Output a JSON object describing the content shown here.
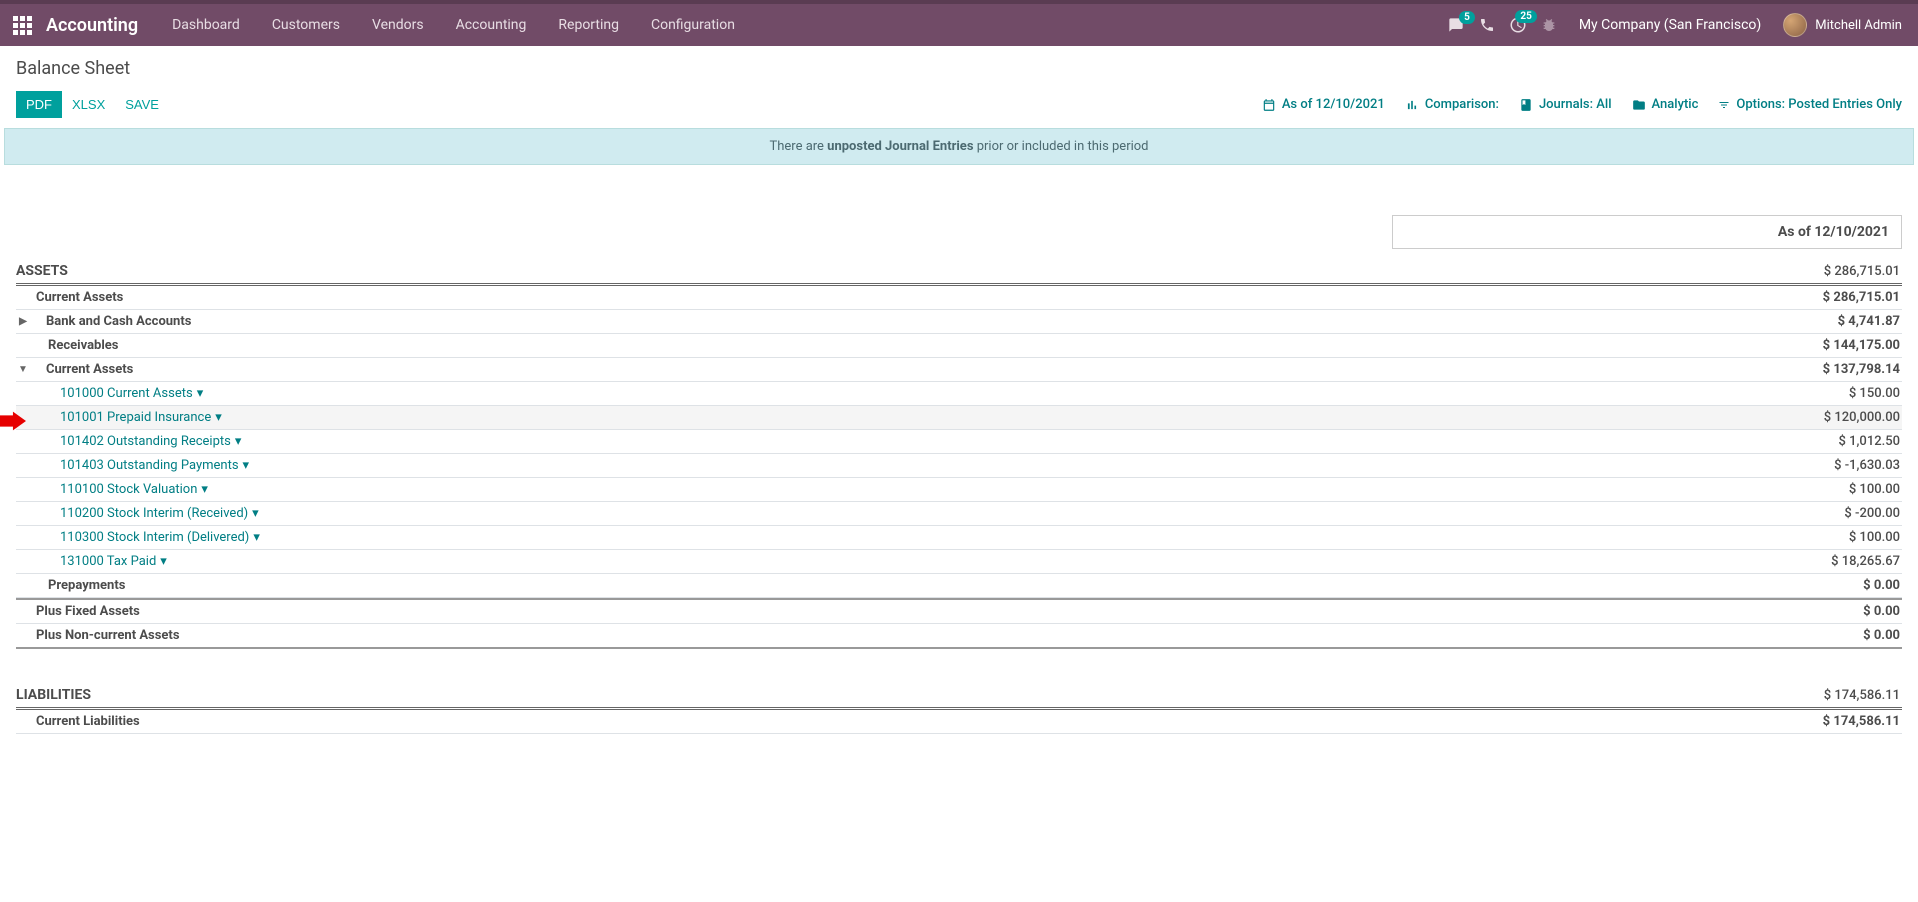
{
  "topbar": {
    "brand": "Accounting",
    "nav": [
      "Dashboard",
      "Customers",
      "Vendors",
      "Accounting",
      "Reporting",
      "Configuration"
    ],
    "messages_badge": "5",
    "activities_badge": "25",
    "company": "My Company (San Francisco)",
    "user": "Mitchell Admin"
  },
  "page": {
    "title": "Balance Sheet",
    "buttons": {
      "pdf": "PDF",
      "xlsx": "XLSX",
      "save": "SAVE"
    },
    "filters": {
      "asof": "As of 12/10/2021",
      "comparison": "Comparison:",
      "journals": "Journals: All",
      "analytic": "Analytic",
      "options": "Options: Posted Entries Only"
    },
    "alert_pre": "There are ",
    "alert_link": "unposted Journal Entries",
    "alert_post": " prior or included in this period",
    "date_header": "As of 12/10/2021"
  },
  "report": {
    "assets": {
      "label": "ASSETS",
      "value": "$ 286,715.01"
    },
    "current_assets_top": {
      "label": "Current Assets",
      "value": "$ 286,715.01"
    },
    "bank_cash": {
      "label": "Bank and Cash Accounts",
      "value": "$ 4,741.87"
    },
    "receivables": {
      "label": "Receivables",
      "value": "$ 144,175.00"
    },
    "current_assets_sub": {
      "label": "Current Assets",
      "value": "$ 137,798.14"
    },
    "accounts": [
      {
        "label": "101000 Current Assets",
        "value": "$ 150.00"
      },
      {
        "label": "101001 Prepaid Insurance",
        "value": "$ 120,000.00",
        "hl": true
      },
      {
        "label": "101402 Outstanding Receipts",
        "value": "$ 1,012.50"
      },
      {
        "label": "101403 Outstanding Payments",
        "value": "$ -1,630.03"
      },
      {
        "label": "110100 Stock Valuation",
        "value": "$ 100.00"
      },
      {
        "label": "110200 Stock Interim (Received)",
        "value": "$ -200.00"
      },
      {
        "label": "110300 Stock Interim (Delivered)",
        "value": "$ 100.00"
      },
      {
        "label": "131000 Tax Paid",
        "value": "$ 18,265.67"
      }
    ],
    "prepayments": {
      "label": "Prepayments",
      "value": "$ 0.00"
    },
    "fixed_assets": {
      "label": "Plus Fixed Assets",
      "value": "$ 0.00"
    },
    "noncurrent": {
      "label": "Plus Non-current Assets",
      "value": "$ 0.00"
    },
    "liabilities": {
      "label": "LIABILITIES",
      "value": "$ 174,586.11"
    },
    "current_liab": {
      "label": "Current Liabilities",
      "value": "$ 174,586.11"
    }
  }
}
